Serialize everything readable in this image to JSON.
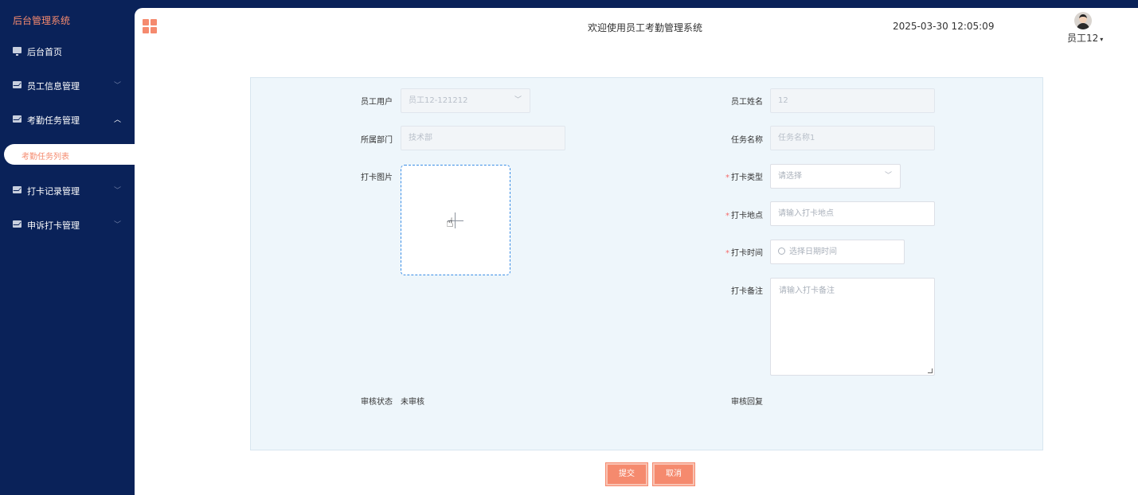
{
  "sidebar": {
    "brand": "后台管理系统",
    "items": [
      {
        "label": "后台首页",
        "arrow": ""
      },
      {
        "label": "员工信息管理",
        "arrow": "﹀"
      },
      {
        "label": "考勤任务管理",
        "arrow": "︿"
      },
      {
        "label": "打卡记录管理",
        "arrow": "﹀"
      },
      {
        "label": "申诉打卡管理",
        "arrow": "﹀"
      }
    ],
    "active_sub": "考勤任务列表"
  },
  "header": {
    "welcome": "欢迎使用员工考勤管理系统",
    "datetime": "2025-03-30 12:05:09",
    "username": "员工12",
    "caret": "▾"
  },
  "form": {
    "employee_user": {
      "label": "员工用户",
      "value": "员工12-121212",
      "arrow": "﹀"
    },
    "employee_name": {
      "label": "员工姓名",
      "value": "12"
    },
    "department": {
      "label": "所属部门",
      "value": "技术部"
    },
    "task_name": {
      "label": "任务名称",
      "value": "任务名称1"
    },
    "punch_image": {
      "label": "打卡图片"
    },
    "punch_type": {
      "required": "*",
      "label": "打卡类型",
      "placeholder": "请选择",
      "arrow": "﹀"
    },
    "punch_location": {
      "required": "*",
      "label": "打卡地点",
      "placeholder": "请输入打卡地点"
    },
    "punch_time": {
      "required": "*",
      "label": "打卡时间",
      "placeholder": "选择日期时间"
    },
    "punch_note": {
      "label": "打卡备注",
      "placeholder": "请输入打卡备注"
    },
    "review_status": {
      "label": "审核状态",
      "value": "未审核"
    },
    "review_reply": {
      "label": "审核回复"
    }
  },
  "buttons": {
    "submit": "提交",
    "cancel": "取消"
  }
}
